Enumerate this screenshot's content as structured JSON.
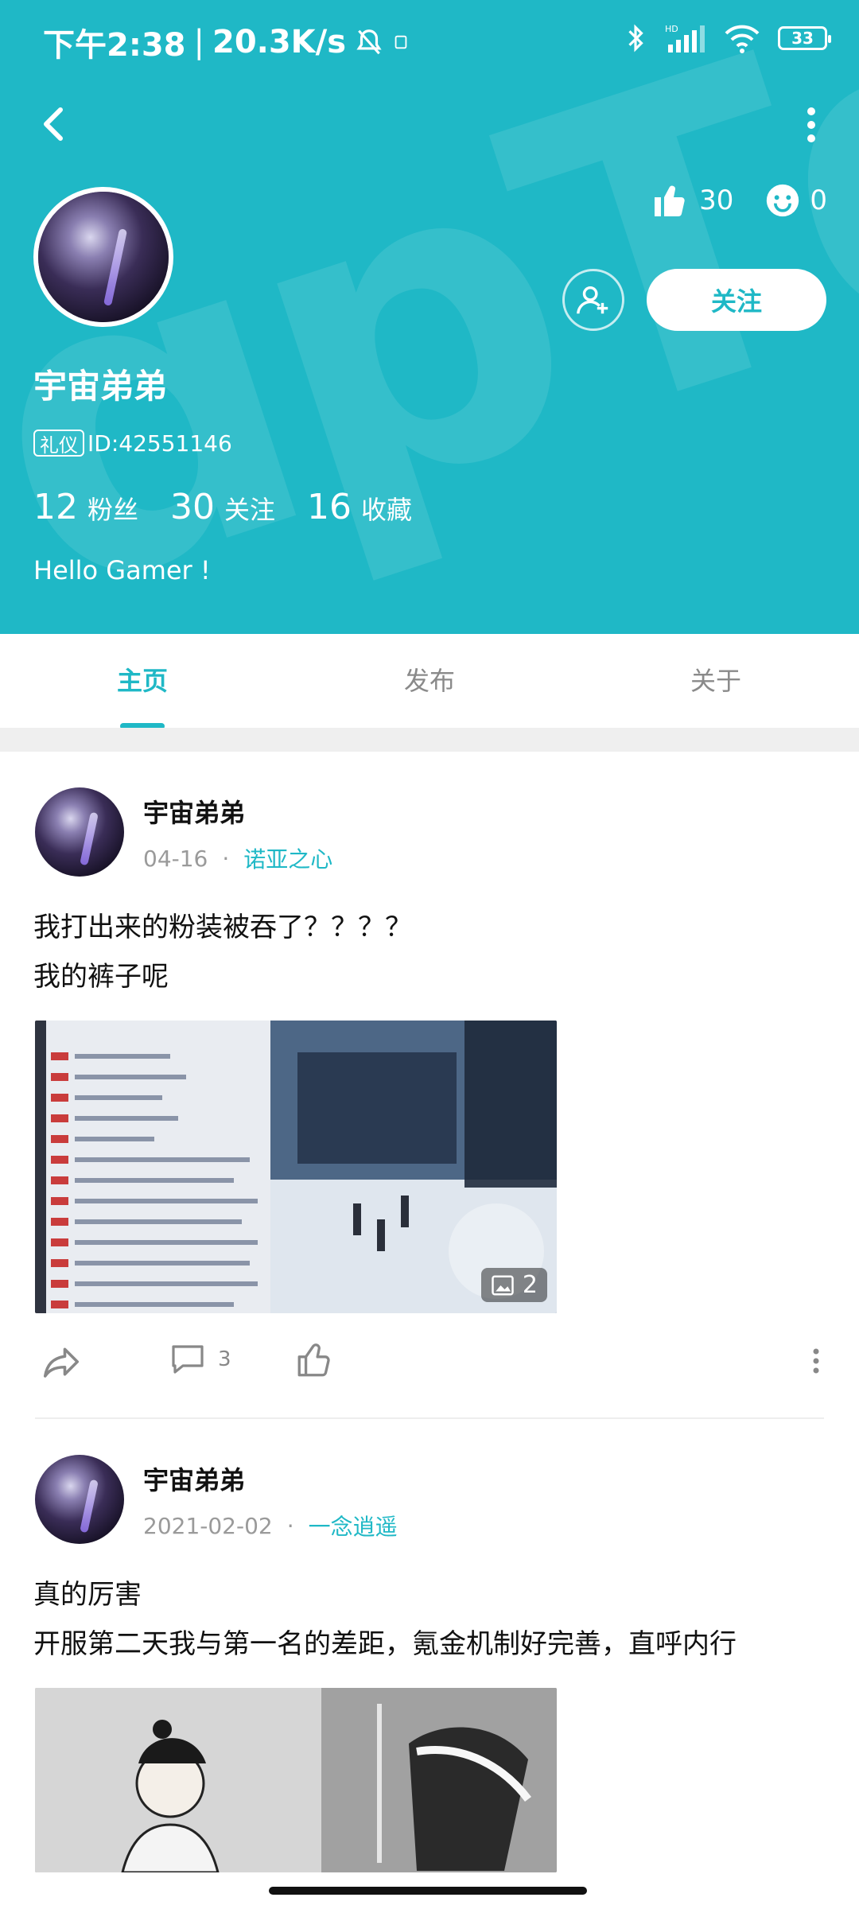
{
  "status_bar": {
    "time": "下午2:38",
    "speed": "20.3K/s",
    "battery": "33"
  },
  "profile": {
    "name": "宇宙弟弟",
    "badge": "礼仪",
    "id_text": "ID:42551146",
    "likes": "30",
    "smiles": "0",
    "follow_label": "关注",
    "fans_num": "12",
    "fans_label": "粉丝",
    "following_num": "30",
    "following_label": "关注",
    "favorites_num": "16",
    "favorites_label": "收藏",
    "bio": "Hello Gamer !"
  },
  "tabs": [
    "主页",
    "发布",
    "关于"
  ],
  "posts": [
    {
      "author": "宇宙弟弟",
      "date": "04-16",
      "category": "诺亚之心",
      "text_line1": "我打出来的粉装被吞了？？？？",
      "text_line2": "我的裤子呢",
      "image_count": "2",
      "comments": "3"
    },
    {
      "author": "宇宙弟弟",
      "date": "2021-02-02",
      "category": "一念逍遥",
      "text_line1": "真的厉害",
      "text_line2": "开服第二天我与第一名的差距，氪金机制好完善，直呼内行"
    }
  ],
  "colors": {
    "accent": "#1fb8c6",
    "header_bg": "#1fb8c6",
    "muted": "#9a9a9a"
  },
  "icons": [
    "back-arrow-icon",
    "more-vert-icon",
    "thumbs-up-icon",
    "smile-icon",
    "add-friend-icon",
    "share-icon",
    "comment-icon",
    "like-icon",
    "image-icon"
  ]
}
